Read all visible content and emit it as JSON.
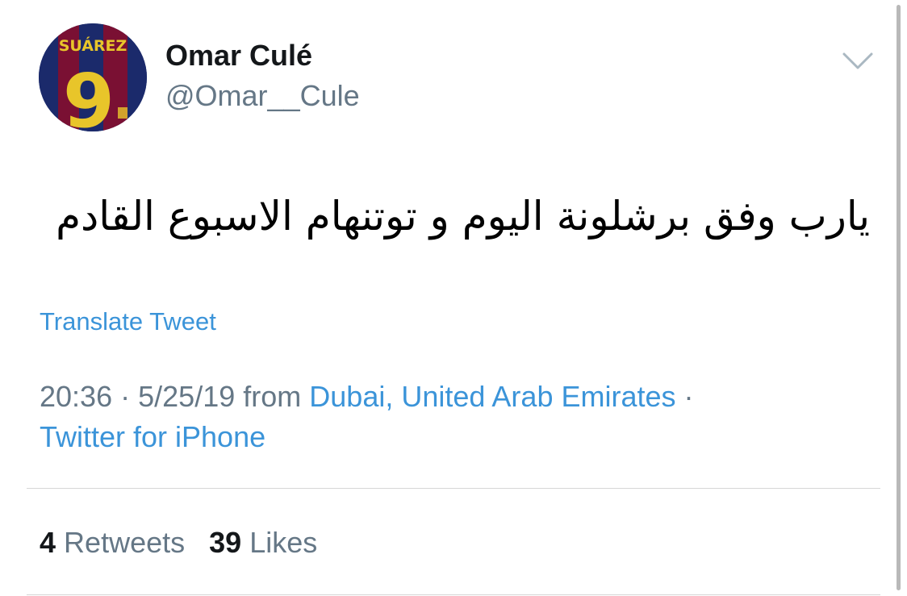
{
  "header": {
    "display_name": "Omar Culé",
    "handle": "@Omar__Cule",
    "avatar": {
      "jersey_name": "SUÁREZ",
      "jersey_number": "9",
      "colors": {
        "blue": "#1b2a6b",
        "garnet": "#7a1033",
        "gold": "#e8c52a"
      }
    },
    "menu_icon": "chevron-down-icon"
  },
  "tweet": {
    "text": "يارب وفق برشلونة اليوم و توتنهام الاسبوع القادم",
    "translate_label": "Translate Tweet"
  },
  "meta": {
    "time": "20:36",
    "separator": "·",
    "date": "5/25/19",
    "from_label": "from",
    "location": "Dubai, United Arab Emirates",
    "source": "Twitter for iPhone"
  },
  "stats": {
    "retweets_count": "4",
    "retweets_label": "Retweets",
    "likes_count": "39",
    "likes_label": "Likes"
  },
  "colors": {
    "link": "#3b94d9",
    "secondary_text": "#657786",
    "primary_text": "#14171a",
    "divider": "#d6d6d6"
  }
}
